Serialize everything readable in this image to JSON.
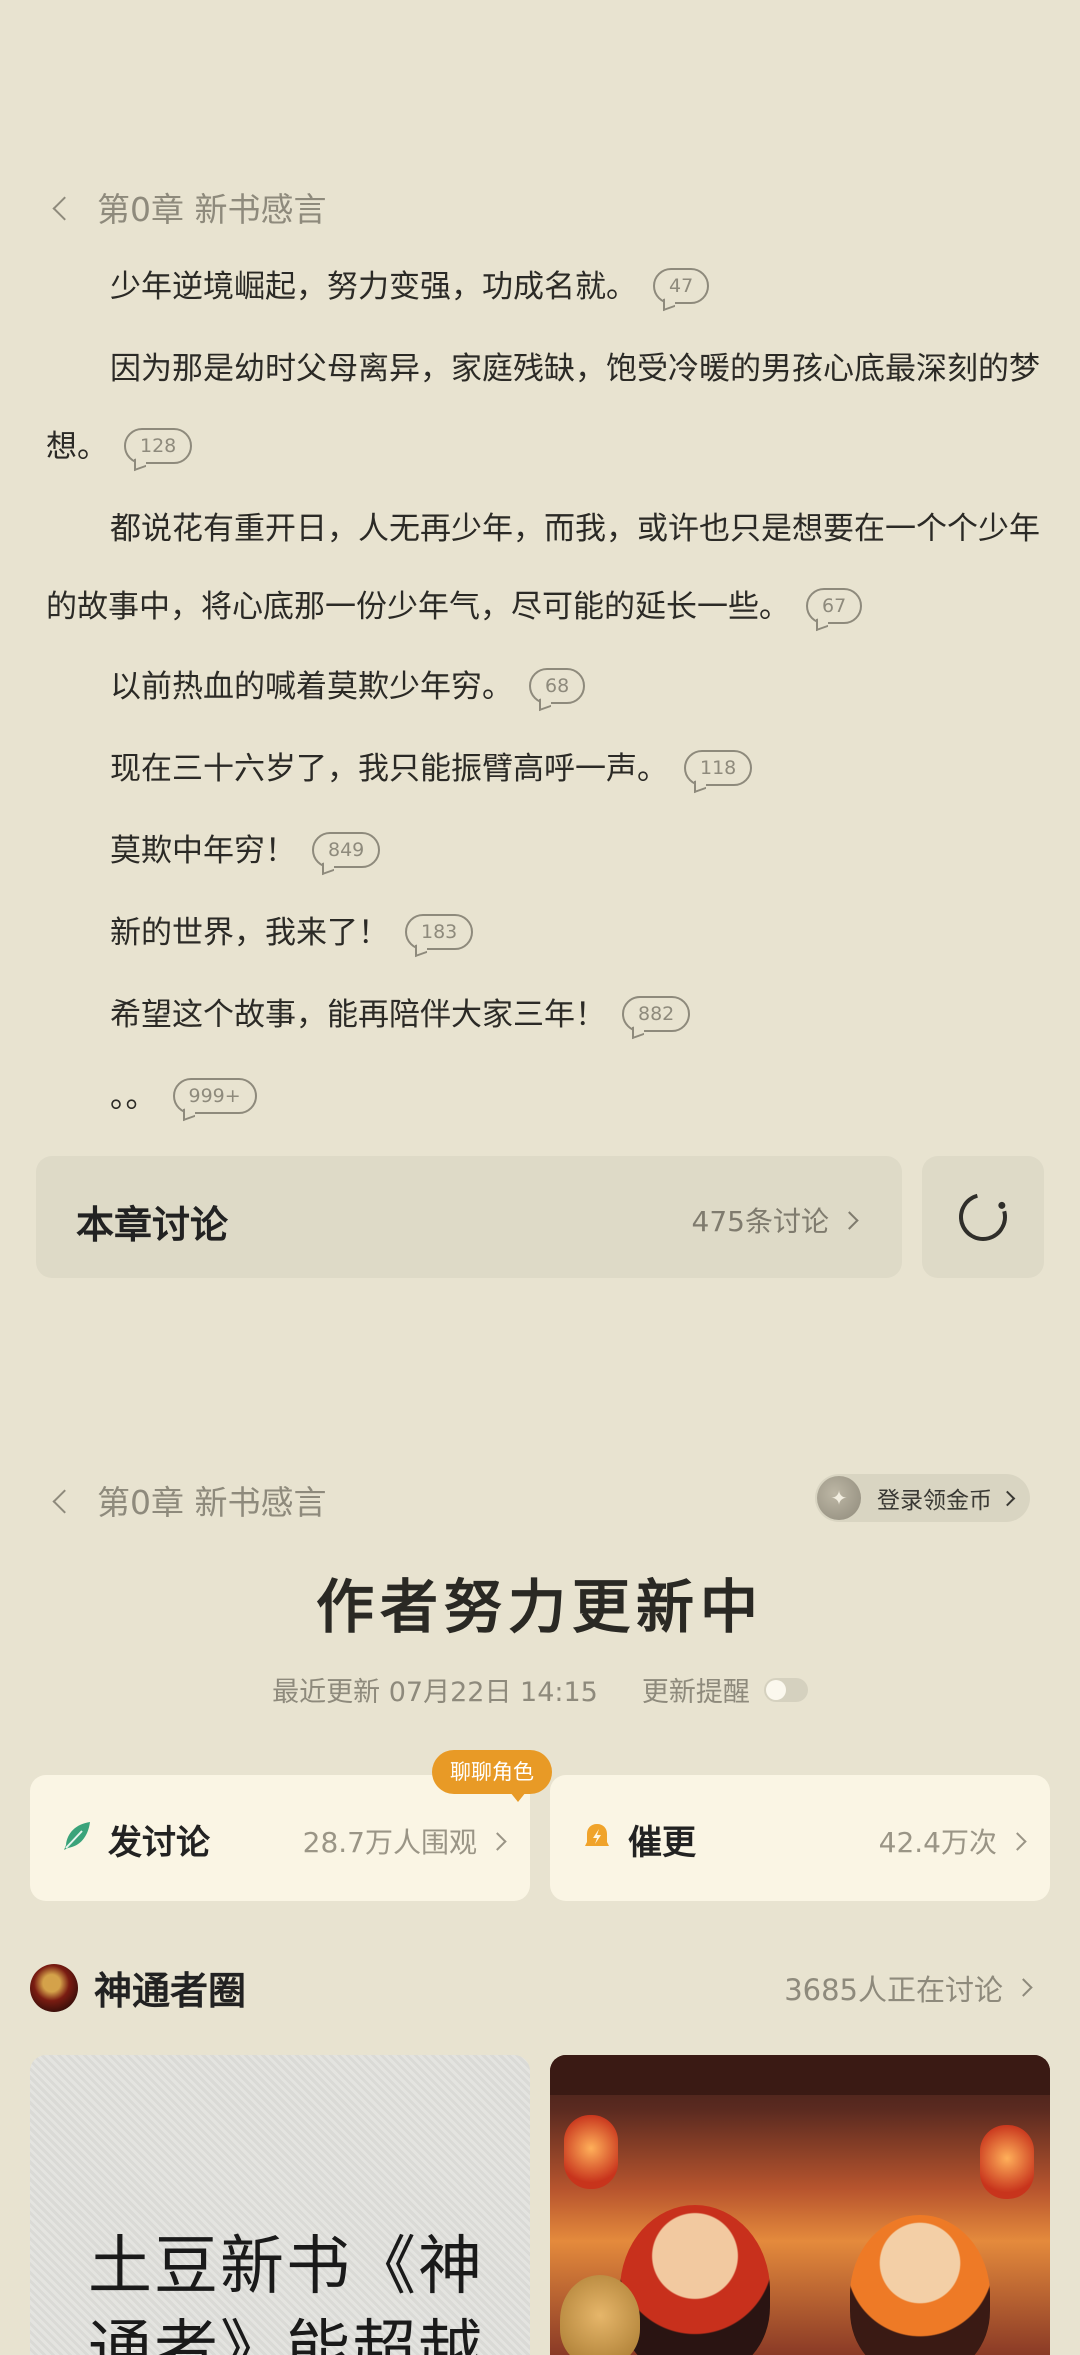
{
  "top_chapter": {
    "title": "第0章  新书感言"
  },
  "paragraphs": [
    {
      "text": "少年逆境崛起，努力变强，功成名就。",
      "comments": "47"
    },
    {
      "text": "因为那是幼时父母离异，家庭残缺，饱受冷暖的男孩心底最深刻的梦想。",
      "comments": "128"
    },
    {
      "text": "都说花有重开日，人无再少年，而我，或许也只是想要在一个个少年的故事中，将心底那一份少年气，尽可能的延长一些。",
      "comments": "67"
    },
    {
      "text": "以前热血的喊着莫欺少年穷。",
      "comments": "68"
    },
    {
      "text": "现在三十六岁了，我只能振臂高呼一声。",
      "comments": "118"
    },
    {
      "text": "莫欺中年穷！",
      "comments": "849"
    },
    {
      "text": "新的世界，我来了！",
      "comments": "183"
    },
    {
      "text": "希望这个故事，能再陪伴大家三年！",
      "comments": "882"
    },
    {
      "text": "。。",
      "comments": "999+"
    }
  ],
  "chapter_discussion": {
    "title": "本章讨论",
    "count": "475条讨论"
  },
  "second_header": {
    "title": "第0章  新书感言",
    "login_coins": "登录领金币"
  },
  "author_status": {
    "title": "作者努力更新中",
    "last_update_label": "最近更新 07月22日 14:15",
    "reminder_label": "更新提醒"
  },
  "actions": {
    "discuss": {
      "label": "发讨论",
      "stat": "28.7万人围观",
      "badge": "聊聊角色"
    },
    "urge": {
      "label": "催更",
      "stat": "42.4万次"
    }
  },
  "circle": {
    "title": "神通者圈",
    "count": "3685人正在讨论"
  },
  "posts": [
    {
      "title": "土豆新书《神通者》能超越"
    }
  ],
  "colors": {
    "background": "#e8e3d0",
    "accent": "#e89a26",
    "feather": "#3aa37a",
    "card": "#faf5e4"
  }
}
